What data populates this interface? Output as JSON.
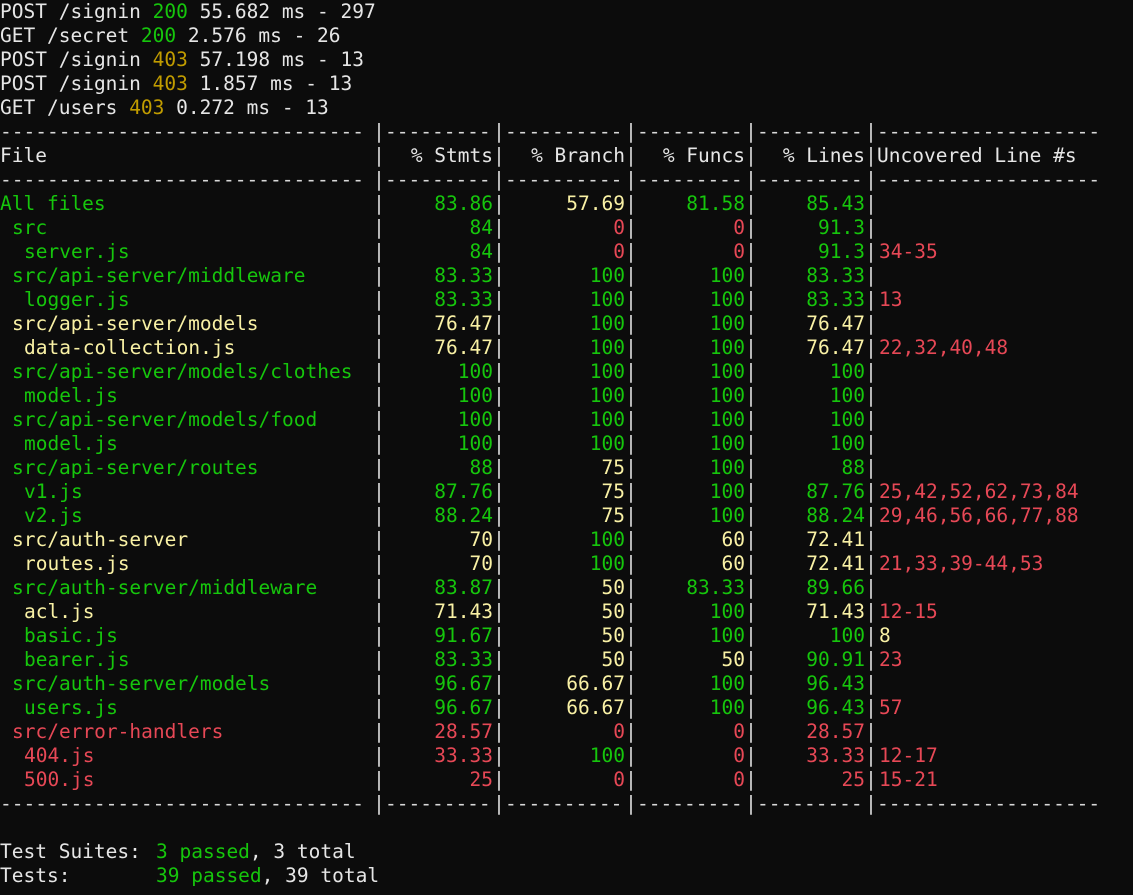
{
  "request_logs": [
    {
      "method": "POST",
      "path": "/signin",
      "status": "200",
      "status_color": "#16c60c",
      "timing": "55.682 ms - 297"
    },
    {
      "method": "GET",
      "path": "/secret",
      "status": "200",
      "status_color": "#16c60c",
      "timing": "2.576 ms - 26"
    },
    {
      "method": "POST",
      "path": "/signin",
      "status": "403",
      "status_color": "#c19c00",
      "timing": "57.198 ms - 13"
    },
    {
      "method": "POST",
      "path": "/signin",
      "status": "403",
      "status_color": "#c19c00",
      "timing": "1.857 ms - 13"
    },
    {
      "method": "GET",
      "path": "/users",
      "status": "403",
      "status_color": "#c19c00",
      "timing": "0.272 ms - 13"
    }
  ],
  "coverage": {
    "divider": {
      "file": "-------------------------------",
      "stmts": "---------",
      "branch": "----------",
      "funcs": "---------",
      "lines": "---------",
      "uncovered": "-------------------"
    },
    "headers": {
      "file": "File",
      "stmts": "% Stmts",
      "branch": "% Branch",
      "funcs": "% Funcs",
      "lines": "% Lines",
      "uncovered": "Uncovered Line #s"
    },
    "rows": [
      {
        "name": "All files",
        "indent": 0,
        "color": "g",
        "stmts": "83.86",
        "stmts_c": "g",
        "branch": "57.69",
        "branch_c": "y",
        "funcs": "81.58",
        "funcs_c": "g",
        "lines": "85.43",
        "lines_c": "g",
        "uncovered": "",
        "unc_c": "r"
      },
      {
        "name": "src",
        "indent": 1,
        "color": "g",
        "stmts": "84",
        "stmts_c": "g",
        "branch": "0",
        "branch_c": "r",
        "funcs": "0",
        "funcs_c": "r",
        "lines": "91.3",
        "lines_c": "g",
        "uncovered": "",
        "unc_c": "r"
      },
      {
        "name": "server.js",
        "indent": 2,
        "color": "g",
        "stmts": "84",
        "stmts_c": "g",
        "branch": "0",
        "branch_c": "r",
        "funcs": "0",
        "funcs_c": "r",
        "lines": "91.3",
        "lines_c": "g",
        "uncovered": "34-35",
        "unc_c": "r"
      },
      {
        "name": "src/api-server/middleware",
        "indent": 1,
        "color": "g",
        "stmts": "83.33",
        "stmts_c": "g",
        "branch": "100",
        "branch_c": "g",
        "funcs": "100",
        "funcs_c": "g",
        "lines": "83.33",
        "lines_c": "g",
        "uncovered": "",
        "unc_c": "r"
      },
      {
        "name": "logger.js",
        "indent": 2,
        "color": "g",
        "stmts": "83.33",
        "stmts_c": "g",
        "branch": "100",
        "branch_c": "g",
        "funcs": "100",
        "funcs_c": "g",
        "lines": "83.33",
        "lines_c": "g",
        "uncovered": "13",
        "unc_c": "r"
      },
      {
        "name": "src/api-server/models",
        "indent": 1,
        "color": "y",
        "stmts": "76.47",
        "stmts_c": "y",
        "branch": "100",
        "branch_c": "g",
        "funcs": "100",
        "funcs_c": "g",
        "lines": "76.47",
        "lines_c": "y",
        "uncovered": "",
        "unc_c": "r"
      },
      {
        "name": "data-collection.js",
        "indent": 2,
        "color": "y",
        "stmts": "76.47",
        "stmts_c": "y",
        "branch": "100",
        "branch_c": "g",
        "funcs": "100",
        "funcs_c": "g",
        "lines": "76.47",
        "lines_c": "y",
        "uncovered": "22,32,40,48",
        "unc_c": "r"
      },
      {
        "name": "src/api-server/models/clothes",
        "indent": 1,
        "color": "g",
        "stmts": "100",
        "stmts_c": "g",
        "branch": "100",
        "branch_c": "g",
        "funcs": "100",
        "funcs_c": "g",
        "lines": "100",
        "lines_c": "g",
        "uncovered": "",
        "unc_c": "r"
      },
      {
        "name": "model.js",
        "indent": 2,
        "color": "g",
        "stmts": "100",
        "stmts_c": "g",
        "branch": "100",
        "branch_c": "g",
        "funcs": "100",
        "funcs_c": "g",
        "lines": "100",
        "lines_c": "g",
        "uncovered": "",
        "unc_c": "r"
      },
      {
        "name": "src/api-server/models/food",
        "indent": 1,
        "color": "g",
        "stmts": "100",
        "stmts_c": "g",
        "branch": "100",
        "branch_c": "g",
        "funcs": "100",
        "funcs_c": "g",
        "lines": "100",
        "lines_c": "g",
        "uncovered": "",
        "unc_c": "r"
      },
      {
        "name": "model.js",
        "indent": 2,
        "color": "g",
        "stmts": "100",
        "stmts_c": "g",
        "branch": "100",
        "branch_c": "g",
        "funcs": "100",
        "funcs_c": "g",
        "lines": "100",
        "lines_c": "g",
        "uncovered": "",
        "unc_c": "r"
      },
      {
        "name": "src/api-server/routes",
        "indent": 1,
        "color": "g",
        "stmts": "88",
        "stmts_c": "g",
        "branch": "75",
        "branch_c": "y",
        "funcs": "100",
        "funcs_c": "g",
        "lines": "88",
        "lines_c": "g",
        "uncovered": "",
        "unc_c": "r"
      },
      {
        "name": "v1.js",
        "indent": 2,
        "color": "g",
        "stmts": "87.76",
        "stmts_c": "g",
        "branch": "75",
        "branch_c": "y",
        "funcs": "100",
        "funcs_c": "g",
        "lines": "87.76",
        "lines_c": "g",
        "uncovered": "25,42,52,62,73,84",
        "unc_c": "r"
      },
      {
        "name": "v2.js",
        "indent": 2,
        "color": "g",
        "stmts": "88.24",
        "stmts_c": "g",
        "branch": "75",
        "branch_c": "y",
        "funcs": "100",
        "funcs_c": "g",
        "lines": "88.24",
        "lines_c": "g",
        "uncovered": "29,46,56,66,77,88",
        "unc_c": "r"
      },
      {
        "name": "src/auth-server",
        "indent": 1,
        "color": "y",
        "stmts": "70",
        "stmts_c": "y",
        "branch": "100",
        "branch_c": "g",
        "funcs": "60",
        "funcs_c": "y",
        "lines": "72.41",
        "lines_c": "y",
        "uncovered": "",
        "unc_c": "r"
      },
      {
        "name": "routes.js",
        "indent": 2,
        "color": "y",
        "stmts": "70",
        "stmts_c": "y",
        "branch": "100",
        "branch_c": "g",
        "funcs": "60",
        "funcs_c": "y",
        "lines": "72.41",
        "lines_c": "y",
        "uncovered": "21,33,39-44,53",
        "unc_c": "r"
      },
      {
        "name": "src/auth-server/middleware",
        "indent": 1,
        "color": "g",
        "stmts": "83.87",
        "stmts_c": "g",
        "branch": "50",
        "branch_c": "y",
        "funcs": "83.33",
        "funcs_c": "g",
        "lines": "89.66",
        "lines_c": "g",
        "uncovered": "",
        "unc_c": "r"
      },
      {
        "name": "acl.js",
        "indent": 2,
        "color": "y",
        "stmts": "71.43",
        "stmts_c": "y",
        "branch": "50",
        "branch_c": "y",
        "funcs": "100",
        "funcs_c": "g",
        "lines": "71.43",
        "lines_c": "y",
        "uncovered": "12-15",
        "unc_c": "r"
      },
      {
        "name": "basic.js",
        "indent": 2,
        "color": "g",
        "stmts": "91.67",
        "stmts_c": "g",
        "branch": "50",
        "branch_c": "y",
        "funcs": "100",
        "funcs_c": "g",
        "lines": "100",
        "lines_c": "g",
        "uncovered": "8",
        "unc_c": "y"
      },
      {
        "name": "bearer.js",
        "indent": 2,
        "color": "g",
        "stmts": "83.33",
        "stmts_c": "g",
        "branch": "50",
        "branch_c": "y",
        "funcs": "50",
        "funcs_c": "y",
        "lines": "90.91",
        "lines_c": "g",
        "uncovered": "23",
        "unc_c": "r"
      },
      {
        "name": "src/auth-server/models",
        "indent": 1,
        "color": "g",
        "stmts": "96.67",
        "stmts_c": "g",
        "branch": "66.67",
        "branch_c": "y",
        "funcs": "100",
        "funcs_c": "g",
        "lines": "96.43",
        "lines_c": "g",
        "uncovered": "",
        "unc_c": "r"
      },
      {
        "name": "users.js",
        "indent": 2,
        "color": "g",
        "stmts": "96.67",
        "stmts_c": "g",
        "branch": "66.67",
        "branch_c": "y",
        "funcs": "100",
        "funcs_c": "g",
        "lines": "96.43",
        "lines_c": "g",
        "uncovered": "57",
        "unc_c": "r"
      },
      {
        "name": "src/error-handlers",
        "indent": 1,
        "color": "r",
        "stmts": "28.57",
        "stmts_c": "r",
        "branch": "0",
        "branch_c": "r",
        "funcs": "0",
        "funcs_c": "r",
        "lines": "28.57",
        "lines_c": "r",
        "uncovered": "",
        "unc_c": "r"
      },
      {
        "name": "404.js",
        "indent": 2,
        "color": "r",
        "stmts": "33.33",
        "stmts_c": "r",
        "branch": "100",
        "branch_c": "g",
        "funcs": "0",
        "funcs_c": "r",
        "lines": "33.33",
        "lines_c": "r",
        "uncovered": "12-17",
        "unc_c": "r"
      },
      {
        "name": "500.js",
        "indent": 2,
        "color": "r",
        "stmts": "25",
        "stmts_c": "r",
        "branch": "0",
        "branch_c": "r",
        "funcs": "0",
        "funcs_c": "r",
        "lines": "25",
        "lines_c": "r",
        "uncovered": "15-21",
        "unc_c": "r"
      }
    ]
  },
  "summary": {
    "suites_label": "Test Suites:",
    "suites_passed": "3 passed",
    "suites_total": ", 3 total",
    "tests_label": "Tests:",
    "tests_passed": "39 passed",
    "tests_total": ", 39 total"
  },
  "colors": {
    "background": "#0c0c0c",
    "green": "#16c60c",
    "yellow": "#f9f1a5",
    "red": "#e74856",
    "amber": "#c19c00",
    "default": "#e6e6e6"
  }
}
